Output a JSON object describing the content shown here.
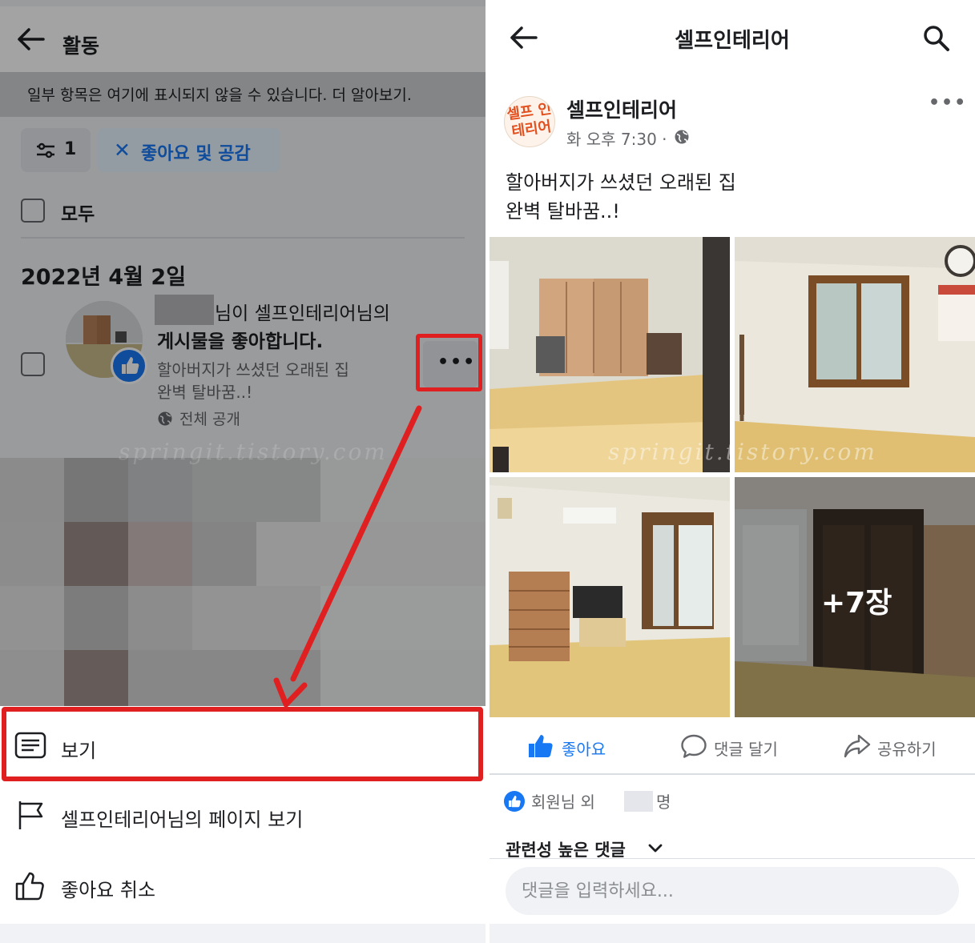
{
  "left": {
    "header": {
      "title": "활동"
    },
    "notice": "일부 항목은 여기에 표시되지 않을 수 있습니다. 더 알아보기.",
    "filters": {
      "count": "1",
      "chip_label": "좋아요 및 공감",
      "chip_remove_glyph": "✕"
    },
    "select_all_label": "모두",
    "date_heading": "2022년 4월 2일",
    "activity": {
      "line1": "님이 셀프인테리어님의",
      "line2": "게시물을 좋아합니다.",
      "excerpt1": "할아버지가 쓰셨던 오래된 집",
      "excerpt2": "완벽 탈바꿈..!",
      "privacy": "전체 공개",
      "more_glyph": "•••"
    },
    "watermark": "springit.tistory.com",
    "sheet": {
      "view_label": "보기",
      "view_page_label": "셀프인테리어님의 페이지 보기",
      "unlike_label": "좋아요 취소"
    }
  },
  "right": {
    "header": {
      "title": "셀프인테리어"
    },
    "post": {
      "avatar_text": "셀프 인테리어",
      "author": "셀프인테리어",
      "time": "화 오후 7:30 ·",
      "text_line1": "할아버지가 쓰셨던 오래된 집",
      "text_line2": "완벽 탈바꿈..!",
      "more_glyph": "•••",
      "more_photos": "+7장"
    },
    "watermark": "springit.tistory.com",
    "actions": {
      "like": "좋아요",
      "comment": "댓글 달기",
      "share": "공유하기"
    },
    "reactions": {
      "prefix": "회원님 외",
      "suffix": "명"
    },
    "comments_sort": "관련성 높은 댓글",
    "comment_placeholder": "댓글을 입력하세요..."
  },
  "colors": {
    "accent": "#1877f2",
    "highlight": "#e02020",
    "background": "#f0f2f5"
  },
  "icons": [
    "back-arrow-icon",
    "filter-sliders-icon",
    "close-icon",
    "checkbox-icon",
    "like-thumb-icon",
    "globe-icon",
    "more-dots-icon",
    "post-view-icon",
    "flag-icon",
    "thumbs-up-outline-icon",
    "search-icon",
    "comment-icon",
    "share-icon",
    "chevron-down-icon"
  ]
}
